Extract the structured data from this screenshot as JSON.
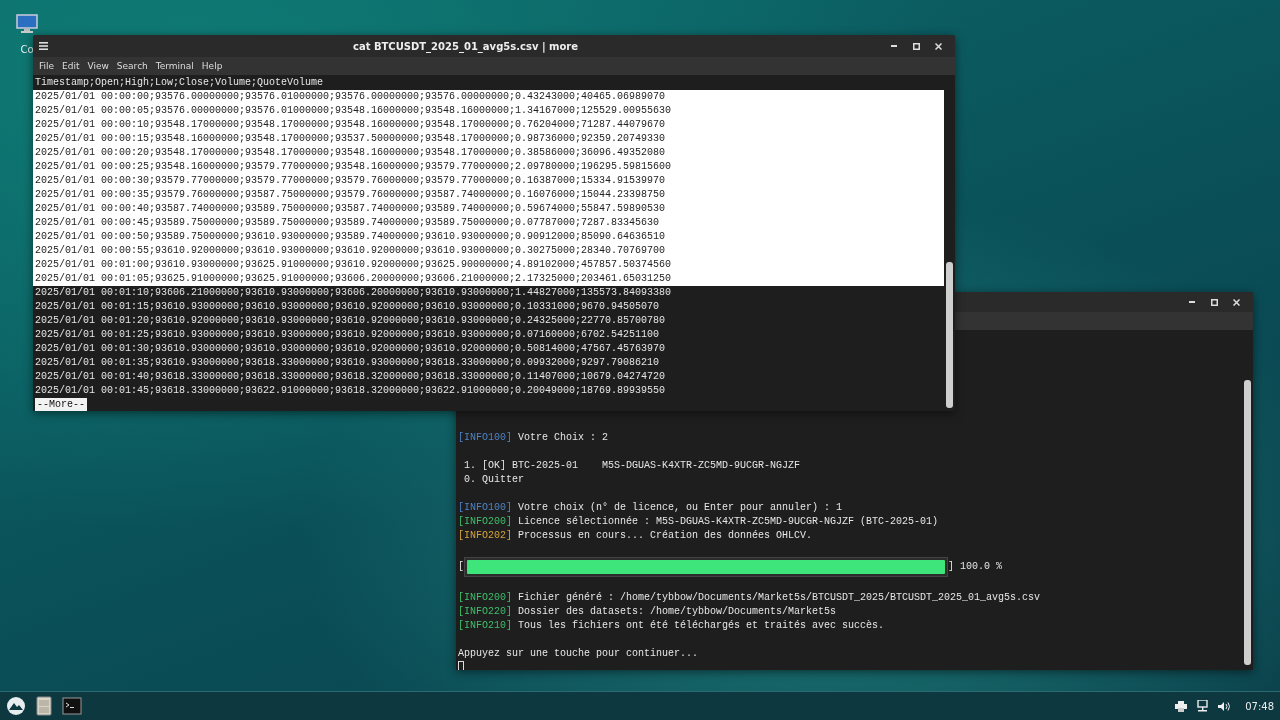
{
  "desktop": {
    "icons": [
      {
        "label": "Co"
      }
    ]
  },
  "windows": [
    {
      "title": "cat BTCUSDT_2025_01_avg5s.csv | more",
      "menu": [
        "File",
        "Edit",
        "View",
        "Search",
        "Terminal",
        "Help"
      ],
      "header": "Timestamp;Open;High;Low;Close;Volume;QuoteVolume",
      "lines": [
        {
          "text": "2025/01/01 00:00:00;93576.00000000;93576.01000000;93576.00000000;93576.00000000;0.43243000;40465.06989070",
          "selected": true
        },
        {
          "text": "2025/01/01 00:00:05;93576.00000000;93576.01000000;93548.16000000;93548.16000000;1.34167000;125529.00955630",
          "selected": true
        },
        {
          "text": "2025/01/01 00:00:10;93548.17000000;93548.17000000;93548.16000000;93548.17000000;0.76204000;71287.44079670",
          "selected": true
        },
        {
          "text": "2025/01/01 00:00:15;93548.16000000;93548.17000000;93537.50000000;93548.17000000;0.98736000;92359.20749330",
          "selected": true
        },
        {
          "text": "2025/01/01 00:00:20;93548.17000000;93548.17000000;93548.16000000;93548.17000000;0.38586000;36096.49352080",
          "selected": true
        },
        {
          "text": "2025/01/01 00:00:25;93548.16000000;93579.77000000;93548.16000000;93579.77000000;2.09780000;196295.59815600",
          "selected": true
        },
        {
          "text": "2025/01/01 00:00:30;93579.77000000;93579.77000000;93579.76000000;93579.77000000;0.16387000;15334.91539970",
          "selected": true
        },
        {
          "text": "2025/01/01 00:00:35;93579.76000000;93587.75000000;93579.76000000;93587.74000000;0.16076000;15044.23398750",
          "selected": true
        },
        {
          "text": "2025/01/01 00:00:40;93587.74000000;93589.75000000;93587.74000000;93589.74000000;0.59674000;55847.59890530",
          "selected": true
        },
        {
          "text": "2025/01/01 00:00:45;93589.75000000;93589.75000000;93589.74000000;93589.75000000;0.07787000;7287.83345630",
          "selected": true
        },
        {
          "text": "2025/01/01 00:00:50;93589.75000000;93610.93000000;93589.74000000;93610.93000000;0.90912000;85090.64636510",
          "selected": true
        },
        {
          "text": "2025/01/01 00:00:55;93610.92000000;93610.93000000;93610.92000000;93610.93000000;0.30275000;28340.70769700",
          "selected": true
        },
        {
          "text": "2025/01/01 00:01:00;93610.93000000;93625.91000000;93610.92000000;93625.90000000;4.89102000;457857.50374560",
          "selected": true
        },
        {
          "text": "2025/01/01 00:01:05;93625.91000000;93625.91000000;93606.20000000;93606.21000000;2.17325000;203461.65031250",
          "selected": true
        },
        {
          "text": "2025/01/01 00:01:10;93606.21000000;93610.93000000;93606.20000000;93610.93000000;1.44827000;135573.84093380",
          "selected": false
        },
        {
          "text": "2025/01/01 00:01:15;93610.93000000;93610.93000000;93610.92000000;93610.93000000;0.10331000;9670.94505070",
          "selected": false
        },
        {
          "text": "2025/01/01 00:01:20;93610.92000000;93610.93000000;93610.92000000;93610.93000000;0.24325000;22770.85700780",
          "selected": false
        },
        {
          "text": "2025/01/01 00:01:25;93610.93000000;93610.93000000;93610.92000000;93610.93000000;0.07160000;6702.54251100",
          "selected": false
        },
        {
          "text": "2025/01/01 00:01:30;93610.93000000;93610.93000000;93610.92000000;93610.92000000;0.50814000;47567.45763970",
          "selected": false
        },
        {
          "text": "2025/01/01 00:01:35;93610.93000000;93618.33000000;93610.93000000;93618.33000000;0.09932000;9297.79086210",
          "selected": false
        },
        {
          "text": "2025/01/01 00:01:40;93618.33000000;93618.33000000;93618.32000000;93618.33000000;0.11407000;10679.04274720",
          "selected": false
        },
        {
          "text": "2025/01/01 00:01:45;93618.33000000;93622.91000000;93618.32000000;93622.91000000;0.20049000;18769.89939550",
          "selected": false
        }
      ],
      "prompt": "--More--"
    },
    {
      "lines": [
        {
          "kind": "text",
          "tag": "[INFO100]",
          "color": "#4f82c4",
          "text": "Votre Choix : 2"
        },
        {
          "kind": "blank"
        },
        {
          "kind": "text",
          "text": " 1. [OK] BTC-2025-01    M5S-DGUAS-K4XTR-ZC5MD-9UCGR-NGJZF"
        },
        {
          "kind": "text",
          "text": " 0. Quitter"
        },
        {
          "kind": "blank"
        },
        {
          "kind": "text",
          "tag": "[INFO100]",
          "color": "#4f82c4",
          "text": "Votre choix (n° de licence, ou Enter pour annuler) : 1"
        },
        {
          "kind": "text",
          "tag": "[INFO200]",
          "color": "#3fbf6a",
          "text": "Licence sélectionnée : M5S-DGUAS-K4XTR-ZC5MD-9UCGR-NGJZF (BTC-2025-01)"
        },
        {
          "kind": "text",
          "tag": "[INFO202]",
          "color": "#d8a33a",
          "text": "Processus en cours... Création des données OHLCV."
        },
        {
          "kind": "blank"
        },
        {
          "kind": "progress",
          "open": "[",
          "close": "]",
          "reading": "100.0 %",
          "level": 1
        },
        {
          "kind": "blank"
        },
        {
          "kind": "text",
          "tag": "[INFO200]",
          "color": "#3fbf6a",
          "text": "Fichier généré : /home/tybbow/Documents/Market5s/BTCUSDT_2025/BTCUSDT_2025_01_avg5s.csv"
        },
        {
          "kind": "text",
          "tag": "[INFO220]",
          "color": "#3fbf6a",
          "text": "Dossier des datasets: /home/tybbow/Documents/Market5s"
        },
        {
          "kind": "text",
          "tag": "[INFO210]",
          "color": "#3fbf6a",
          "text": "Tous les fichiers ont été téléchargés et traités avec succès."
        },
        {
          "kind": "blank"
        },
        {
          "kind": "text",
          "text": "Appuyez sur une touche pour continuer..."
        },
        {
          "kind": "cursor"
        }
      ]
    }
  ],
  "taskbar": {
    "clock": "07:48"
  }
}
